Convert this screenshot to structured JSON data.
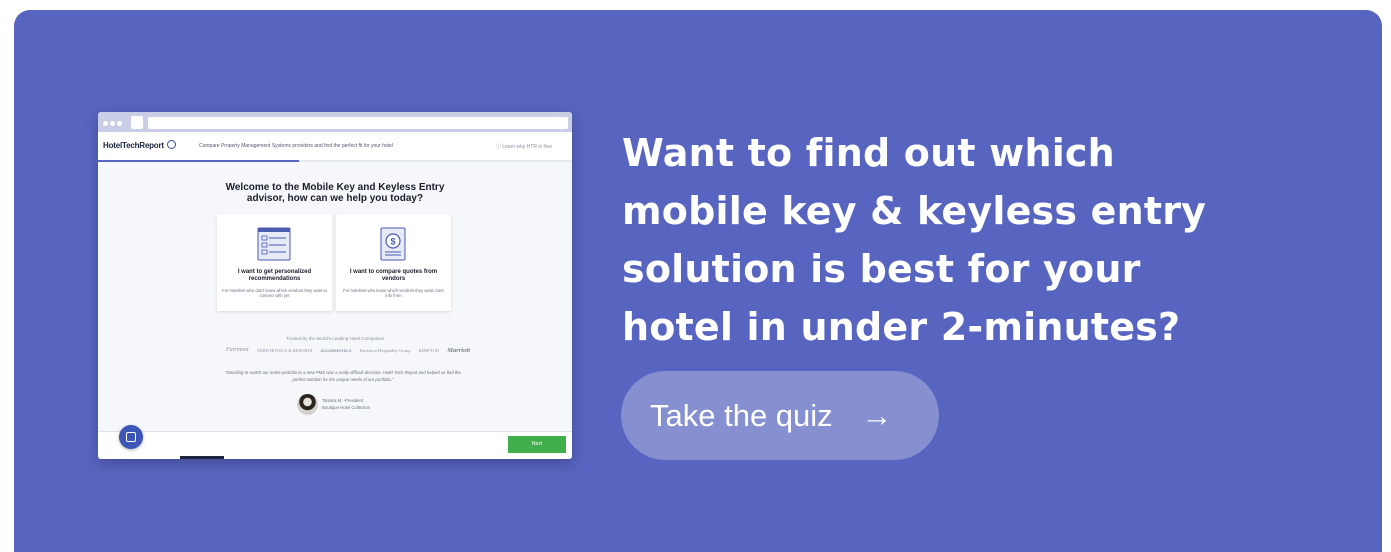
{
  "colors": {
    "banner_bg": "#5765c0",
    "cta_bg": "#8690d1",
    "next_button": "#3fae4b",
    "accent": "#5765c0"
  },
  "mockup": {
    "logo": "HotelTechReport",
    "tagline": "Compare Property Management Systems providers and find the perfect fit for your hotel",
    "learn_link": "ⓘ Learn why HTR is free",
    "welcome": "Welcome to the Mobile Key and Keyless Entry advisor, how can we help you today?",
    "options": [
      {
        "title": "I want to get personalized recommendations",
        "subtitle": "For hoteliers who don't know which vendors they want to connect with yet",
        "icon": "checklist-icon"
      },
      {
        "title": "I want to compare quotes from vendors",
        "subtitle": "For hoteliers who know which vendors they want more info from",
        "icon": "dollar-document-icon"
      }
    ],
    "trusted_label": "Trusted By the World's Leading Hotel Companies",
    "trusted_logos": [
      "Fairmont",
      "OMNI HOTELS & RESORTS",
      "ACCORHOTELS",
      "Davidson Hospitality Group",
      "KIMPTON",
      "Marriott"
    ],
    "quote": "\"Deciding to switch our entire portfolio to a new PMS was a really difficult decision. Hotel Tech Report and helped us find the perfect solution for the unique needs of our portfolio.\"",
    "person_name": "Tamara M. -President",
    "person_company": "Boutique Hotel Collection",
    "next_label": "Next"
  },
  "headline": "Want to find out which mobile key & keyless entry solution is best for your hotel in under 2-minutes?",
  "cta": {
    "label": "Take the quiz",
    "arrow": "→"
  }
}
